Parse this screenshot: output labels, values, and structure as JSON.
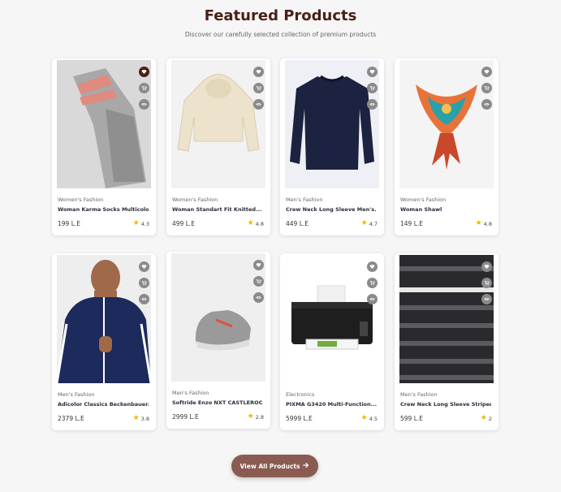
{
  "header": {
    "title": "Featured Products",
    "subtitle": "Discover our carefully selected collection of premium products"
  },
  "products": [
    {
      "category": "Women's Fashion",
      "name": "Woman Karma Socks Multicolour",
      "price": "199 L.E",
      "rating": "4.3",
      "wishlisted": true,
      "image": "grey-socks"
    },
    {
      "category": "Women's Fashion",
      "name": "Woman Standart Fit Knitted...",
      "price": "499 L.E",
      "rating": "4.8",
      "wishlisted": false,
      "image": "beige-hoodie"
    },
    {
      "category": "Men's Fashion",
      "name": "Crew Neck Long Sleeve Men's...",
      "price": "449 L.E",
      "rating": "4.7",
      "wishlisted": false,
      "image": "navy-sweater"
    },
    {
      "category": "Women's Fashion",
      "name": "Woman Shawl",
      "price": "149 L.E",
      "rating": "4.8",
      "wishlisted": false,
      "image": "colorful-scarf"
    },
    {
      "category": "Men's Fashion",
      "name": "Adicolor Classics Beckenbauer...",
      "price": "2379 L.E",
      "rating": "3.8",
      "wishlisted": false,
      "image": "track-jacket"
    },
    {
      "category": "Men's Fashion",
      "name": "Softride Enzo NXT CASTLEROCK...",
      "price": "2999 L.E",
      "rating": "2.8",
      "wishlisted": false,
      "image": "grey-sneaker"
    },
    {
      "category": "Electronics",
      "name": "PIXMA G3420 Multi-Function...",
      "price": "5999 L.E",
      "rating": "4.5",
      "wishlisted": false,
      "image": "printer"
    },
    {
      "category": "Men's Fashion",
      "name": "Crew Neck Long Sleeve Striped...",
      "price": "599 L.E",
      "rating": "2",
      "wishlisted": false,
      "image": "striped-sweater"
    }
  ],
  "actions": {
    "wishlist_icon": "heart-icon",
    "cart_icon": "cart-icon",
    "quickview_icon": "eye-icon"
  },
  "footer": {
    "view_all_label": "View All Products",
    "view_all_icon": "arrow-right-icon"
  },
  "colors": {
    "accent": "#4a1f16",
    "button": "#8a5b52",
    "icon_bg": "#8a8a8a",
    "star": "#f4b400"
  }
}
